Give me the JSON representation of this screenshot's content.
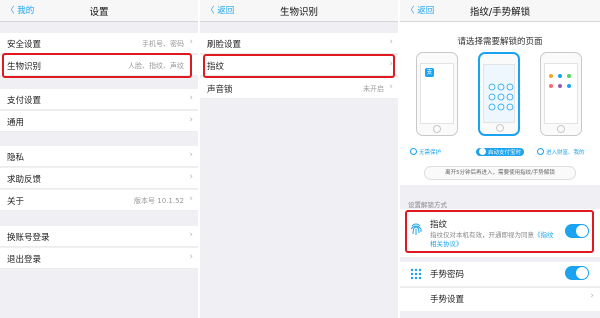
{
  "panel1": {
    "back": "〈 我的",
    "title": "设置",
    "rows": [
      {
        "label": "安全设置",
        "value": "手机号、密码"
      },
      {
        "label": "生物识别",
        "value": "人脸、指纹、声纹"
      },
      {
        "label": "支付设置",
        "value": ""
      },
      {
        "label": "通用",
        "value": ""
      },
      {
        "label": "隐私",
        "value": ""
      },
      {
        "label": "求助反馈",
        "value": ""
      },
      {
        "label": "关于",
        "value": "版本号 10.1.52"
      },
      {
        "label": "换账号登录",
        "value": ""
      },
      {
        "label": "退出登录",
        "value": ""
      }
    ]
  },
  "panel2": {
    "back": "〈 返回",
    "title": "生物识别",
    "rows": [
      {
        "label": "刷脸设置",
        "value": ""
      },
      {
        "label": "指纹",
        "value": ""
      },
      {
        "label": "声音锁",
        "value": "未开启"
      }
    ]
  },
  "panel3": {
    "back": "〈 返回",
    "title": "指纹/手势解锁",
    "heading": "请选择需要解锁的页面",
    "options": [
      "无需保护",
      "启动支付宝时",
      "进入财富、我的"
    ],
    "hint": "离开5分钟后再进入，需要使用指纹/手势解锁",
    "section_title": "设置解锁方式",
    "fingerprint": {
      "title": "指纹",
      "desc": "指纹仅对本机有效，开通即视为同意",
      "link": "《指纹相关协议》"
    },
    "gesture_password": "手势密码",
    "gesture_settings": "手势设置"
  },
  "colors": {
    "accent": "#1aa3f0",
    "highlight": "#e0181f"
  },
  "icons": {
    "chevron": "chevron-right-icon",
    "fingerprint": "fingerprint-icon",
    "gesture": "gesture-grid-icon"
  }
}
